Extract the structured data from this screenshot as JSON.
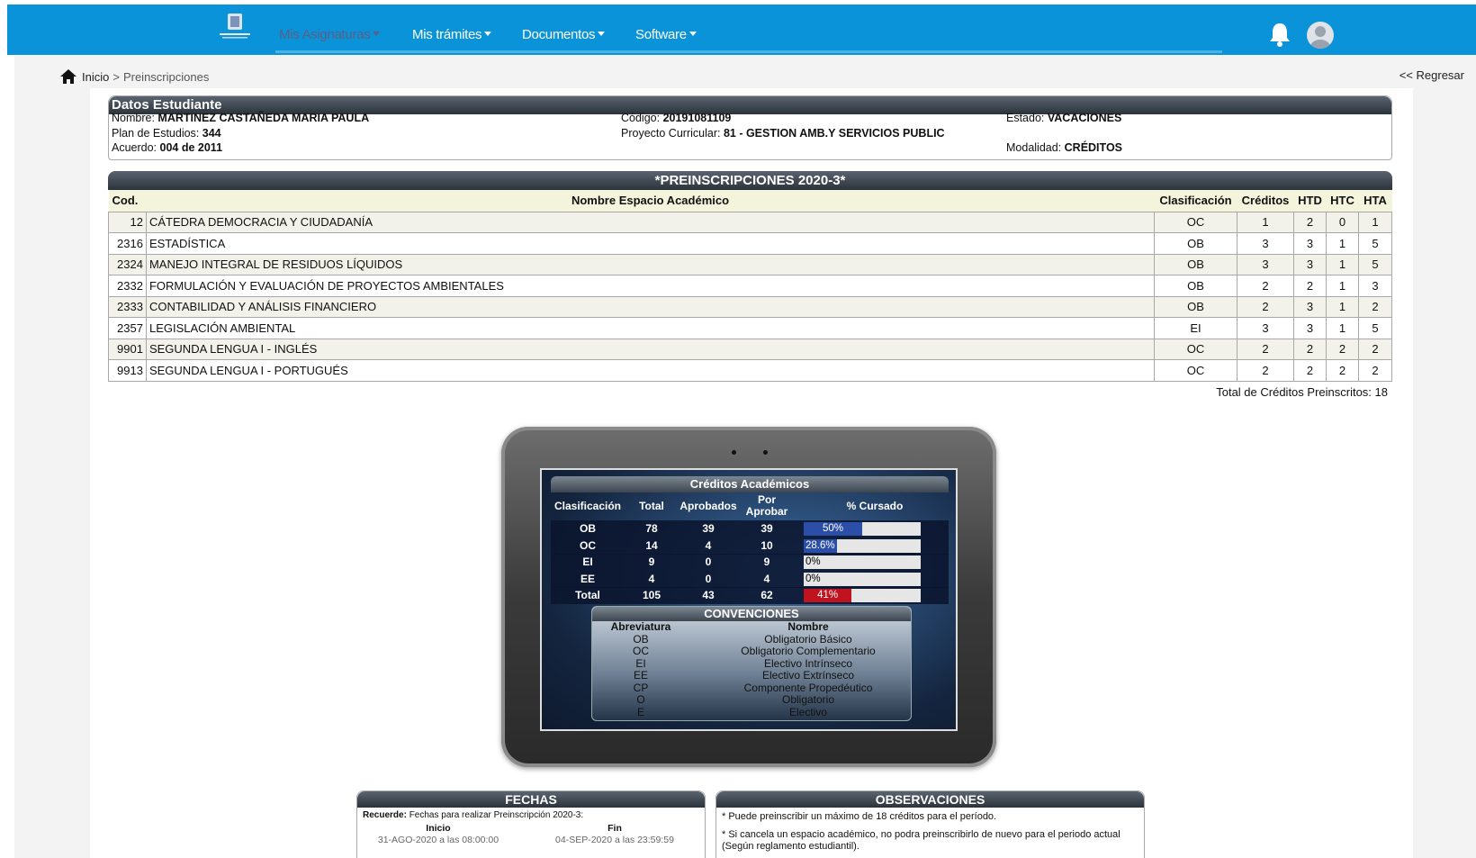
{
  "nav": {
    "items": [
      {
        "label": "Mis Asignaturas"
      },
      {
        "label": "Mis trámites"
      },
      {
        "label": "Documentos"
      },
      {
        "label": "Software"
      }
    ]
  },
  "breadcrumb": {
    "home": "Inicio",
    "sep": ">",
    "current": "Preinscripciones"
  },
  "back_link": "<< Regresar",
  "student": {
    "title": "Datos Estudiante",
    "nombre_label": "Nombre:",
    "nombre": "MARTINEZ CASTAÑEDA MARIA PAULA",
    "plan_label": "Plan de Estudios:",
    "plan": "344",
    "acuerdo_label": "Acuerdo:",
    "acuerdo": "004 de 2011",
    "codigo_label": "Código:",
    "codigo": "20191081109",
    "proyecto_label": "Proyecto Curricular:",
    "proyecto": "81 - GESTION AMB.Y SERVICIOS PUBLIC",
    "estado_label": "Estado:",
    "estado": "VACACIONES",
    "modalidad_label": "Modalidad:",
    "modalidad": "CRÉDITOS"
  },
  "prereg": {
    "title": "*PREINSCRIPCIONES 2020-3*",
    "headers": [
      "Cod.",
      "Nombre Espacio Académico",
      "Clasificación",
      "Créditos",
      "HTD",
      "HTC",
      "HTA"
    ],
    "rows": [
      [
        "12",
        "CÁTEDRA DEMOCRACIA Y CIUDADANÍA",
        "OC",
        "1",
        "2",
        "0",
        "1"
      ],
      [
        "2316",
        "ESTADÍSTICA",
        "OB",
        "3",
        "3",
        "1",
        "5"
      ],
      [
        "2324",
        "MANEJO INTEGRAL DE RESIDUOS LÍQUIDOS",
        "OB",
        "3",
        "3",
        "1",
        "5"
      ],
      [
        "2332",
        "FORMULACIÓN Y EVALUACIÓN DE PROYECTOS AMBIENTALES",
        "OB",
        "2",
        "2",
        "1",
        "3"
      ],
      [
        "2333",
        "CONTABILIDAD Y ANÁLISIS FINANCIERO",
        "OB",
        "2",
        "3",
        "1",
        "2"
      ],
      [
        "2357",
        "LEGISLACIÓN AMBIENTAL",
        "EI",
        "3",
        "3",
        "1",
        "5"
      ],
      [
        "9901",
        "SEGUNDA LENGUA I - INGLÉS",
        "OC",
        "2",
        "2",
        "2",
        "2"
      ],
      [
        "9913",
        "SEGUNDA LENGUA I - PORTUGUÉS",
        "OC",
        "2",
        "2",
        "2",
        "2"
      ]
    ],
    "total_label": "Total de Créditos Preinscritos: 18"
  },
  "credits": {
    "title": "Créditos Académicos",
    "headers": {
      "clas": "Clasificación",
      "total": "Total",
      "aprob": "Aprobados",
      "por1": "Por",
      "por2": "Aprobar",
      "pct": "% Cursado"
    },
    "rows": [
      {
        "clas": "OB",
        "total": "78",
        "aprob": "39",
        "por": "39",
        "pct_label": "50%",
        "fraction": 0.5,
        "color": "#2b4ea8",
        "text_color": "#ffffff",
        "pct_center": true
      },
      {
        "clas": "OC",
        "total": "14",
        "aprob": "4",
        "por": "10",
        "pct_label": "28.6%",
        "fraction": 0.286,
        "color": "#2b4ea8",
        "text_color": "#ffffff",
        "pct_center": false
      },
      {
        "clas": "EI",
        "total": "9",
        "aprob": "0",
        "por": "9",
        "pct_label": "0%",
        "fraction": 0,
        "color": "#2b4ea8",
        "text_color": "#000000",
        "pct_center": false
      },
      {
        "clas": "EE",
        "total": "4",
        "aprob": "0",
        "por": "4",
        "pct_label": "0%",
        "fraction": 0,
        "color": "#2b4ea8",
        "text_color": "#000000",
        "pct_center": false
      },
      {
        "clas": "Total",
        "total": "105",
        "aprob": "43",
        "por": "62",
        "pct_label": "41%",
        "fraction": 0.41,
        "color": "#c1121f",
        "text_color": "#ffffff",
        "pct_center": true
      }
    ]
  },
  "conventions": {
    "title": "CONVENCIONES",
    "headers": {
      "ab": "Abreviatura",
      "nm": "Nombre"
    },
    "rows": [
      {
        "ab": "OB",
        "nm": "Obligatorio Básico"
      },
      {
        "ab": "OC",
        "nm": "Obligatorio Complementario"
      },
      {
        "ab": "EI",
        "nm": "Electivo Intrínseco"
      },
      {
        "ab": "EE",
        "nm": "Electivo Extrínseco"
      },
      {
        "ab": "CP",
        "nm": "Componente Propedéutico"
      },
      {
        "ab": "O",
        "nm": "Obligatorio"
      },
      {
        "ab": "E",
        "nm": "Electivo"
      }
    ]
  },
  "fechas": {
    "title": "FECHAS",
    "recuerde_label": "Recuerde:",
    "recuerde": "Fechas para realizar Preinscripción 2020-3:",
    "inicio_label": "Inicio",
    "inicio": "31-AGO-2020 a las 08:00:00",
    "fin_label": "Fin",
    "fin": "04-SEP-2020 a las 23:59:59"
  },
  "obs": {
    "title": "OBSERVACIONES",
    "items": [
      "* Puede preinscribir un máximo de 18 créditos para el período.",
      "* Si cancela un espacio académico, no podra preinscribirlo de nuevo para el periodo actual (Según reglamento estudiantil)."
    ]
  }
}
